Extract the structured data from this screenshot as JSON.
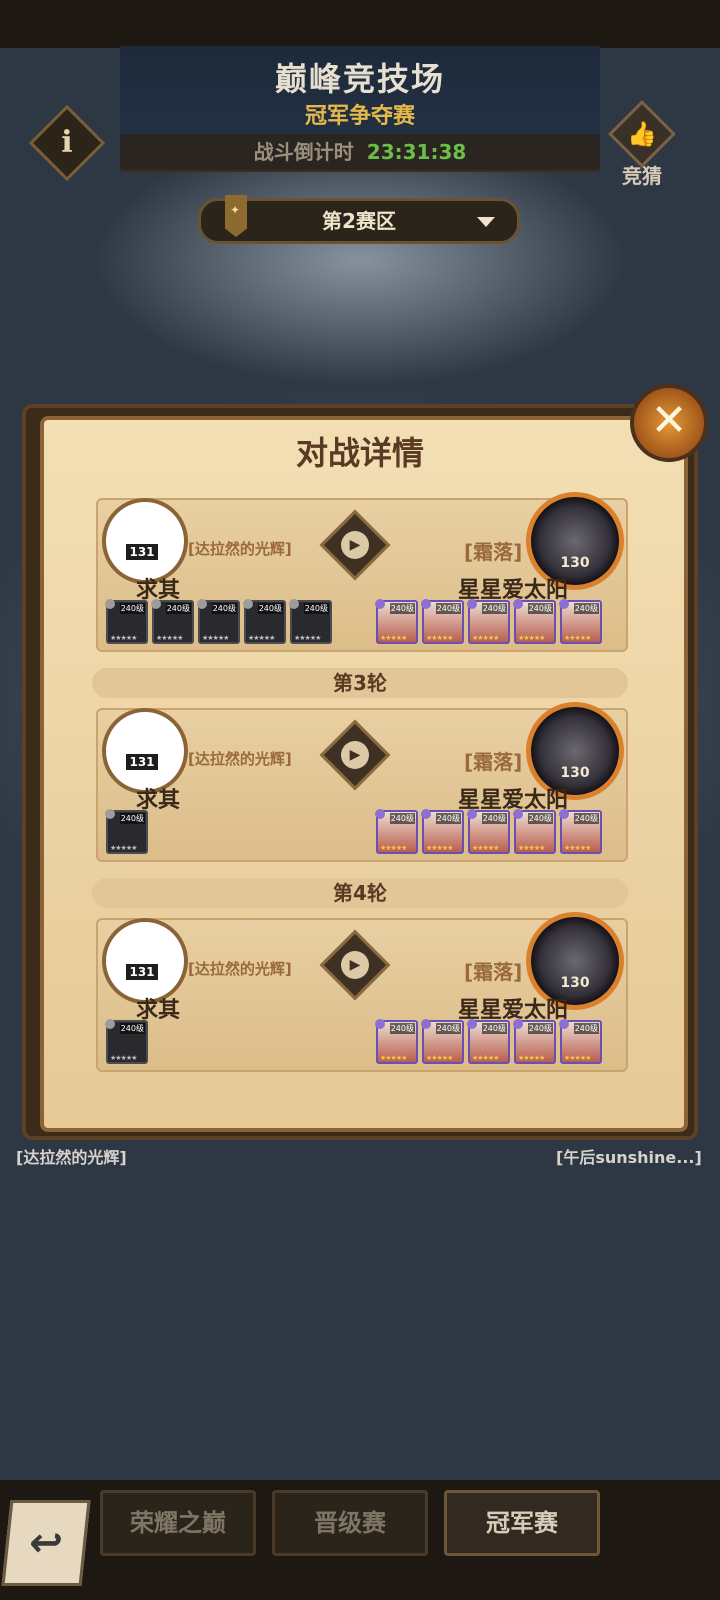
{
  "header": {
    "title": "巅峰竞技场",
    "subtitle": "冠军争夺赛",
    "countdown_label": "战斗倒计时",
    "countdown_value": "23:31:38",
    "info_icon": "i",
    "guess_label": "竞猜"
  },
  "zone_select": {
    "label": "第2赛区"
  },
  "background_names": {
    "left": "[达拉然的光辉]",
    "right": "[午后sunshine...]"
  },
  "dialog": {
    "title": "对战详情",
    "close_symbol": "✕",
    "matches": [
      {
        "left": {
          "level": "131",
          "guild": "[达拉然的光辉]",
          "name": "求其",
          "heroes": [
            "240级",
            "240级",
            "240级",
            "240级",
            "240级"
          ]
        },
        "right": {
          "level": "130",
          "guild": "[霜落]",
          "name": "星星爱太阳",
          "heroes": [
            "240级",
            "240级",
            "240级",
            "240级",
            "240级"
          ]
        }
      },
      {
        "round_label": "第3轮",
        "left": {
          "level": "131",
          "guild": "[达拉然的光辉]",
          "name": "求其",
          "heroes": [
            "240级"
          ]
        },
        "right": {
          "level": "130",
          "guild": "[霜落]",
          "name": "星星爱太阳",
          "heroes": [
            "240级",
            "240级",
            "240级",
            "240级",
            "240级"
          ]
        }
      },
      {
        "round_label": "第4轮",
        "left": {
          "level": "131",
          "guild": "[达拉然的光辉]",
          "name": "求其",
          "heroes": [
            "240级"
          ]
        },
        "right": {
          "level": "130",
          "guild": "[霜落]",
          "name": "星星爱太阳",
          "heroes": [
            "240级",
            "240级",
            "240级",
            "240级",
            "240级"
          ]
        }
      }
    ]
  },
  "bottom_nav": {
    "tabs": [
      {
        "label": "荣耀之巅"
      },
      {
        "label": "晋级赛"
      },
      {
        "label": "冠军赛"
      }
    ]
  },
  "colors": {
    "accent_gold": "#e4b84a",
    "timer_green": "#6dbe46",
    "panel": "#f3dfb4"
  }
}
